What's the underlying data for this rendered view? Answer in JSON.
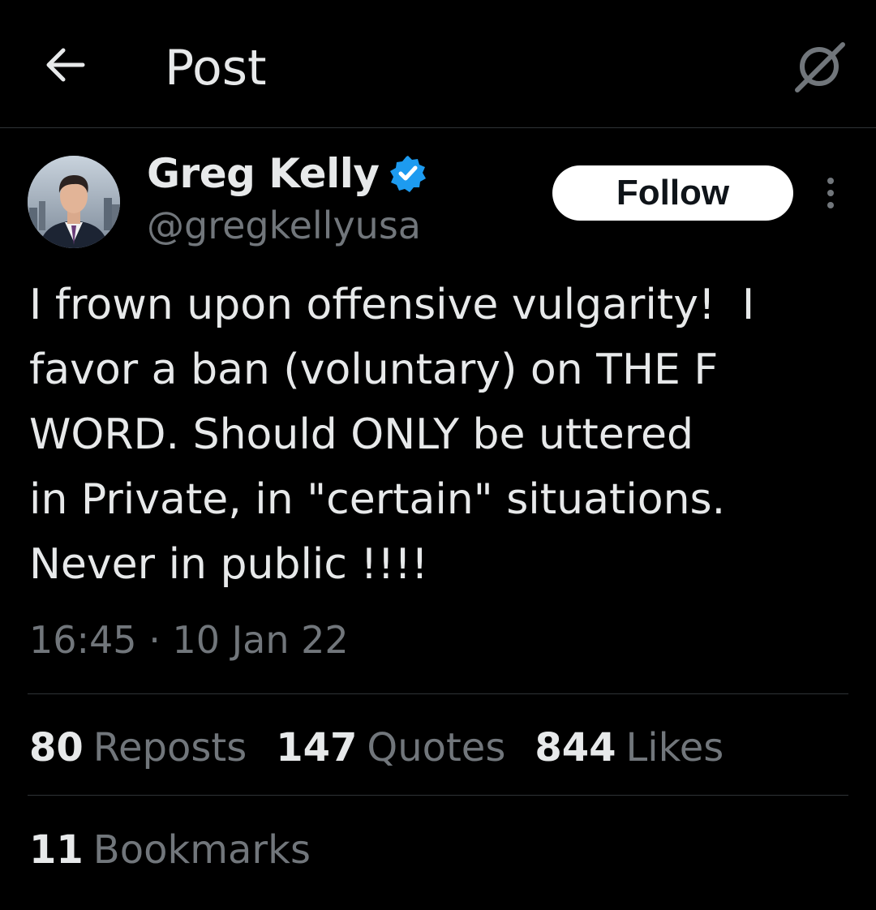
{
  "header": {
    "title": "Post",
    "back_icon": "arrow-left-icon",
    "grok_icon": "grok-icon"
  },
  "author": {
    "name": "Greg Kelly",
    "handle": "@gregkellyusa",
    "verified": true,
    "verified_color": "#1d9bf0"
  },
  "follow_button": {
    "label": "Follow"
  },
  "more_icon": "more-vertical-icon",
  "tweet": {
    "text": "I frown upon offensive vulgarity!  I\nfavor a ban (voluntary) on THE F\nWORD. Should ONLY be uttered\nin Private, in \"certain\" situations.\nNever in public !!!!",
    "time": "16:45",
    "separator": "·",
    "date": "10 Jan 22"
  },
  "stats": {
    "reposts": {
      "count": "80",
      "label": "Reposts"
    },
    "quotes": {
      "count": "147",
      "label": "Quotes"
    },
    "likes": {
      "count": "844",
      "label": "Likes"
    },
    "bookmarks": {
      "count": "11",
      "label": "Bookmarks"
    }
  },
  "colors": {
    "background": "#000000",
    "text_primary": "#e7e9ea",
    "text_secondary": "#71767b",
    "divider": "#2f3336",
    "verified": "#1d9bf0"
  }
}
